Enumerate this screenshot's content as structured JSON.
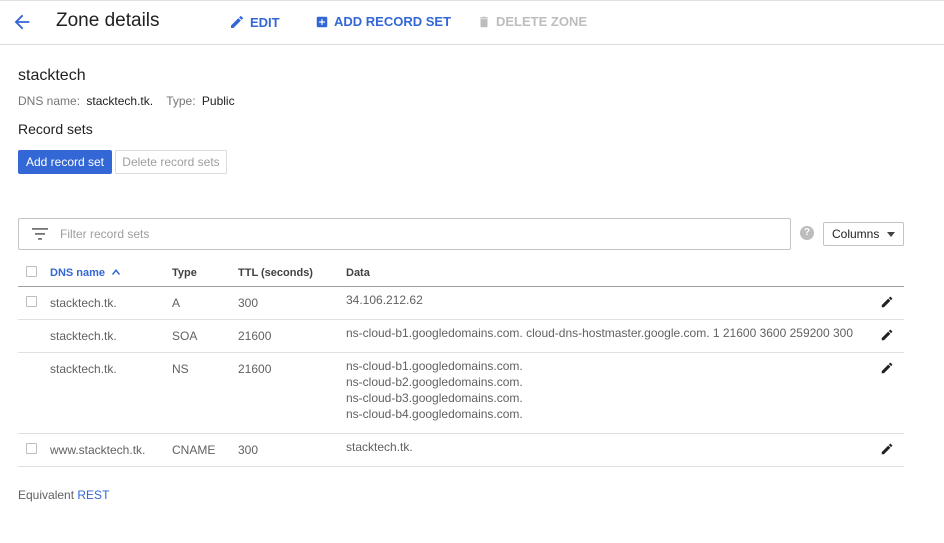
{
  "header": {
    "title": "Zone details",
    "edit_label": "EDIT",
    "add_record_set_label": "ADD RECORD SET",
    "delete_zone_label": "DELETE ZONE"
  },
  "zone": {
    "name": "stacktech",
    "dns_name_label": "DNS name:",
    "dns_name": "stacktech.tk.",
    "type_label": "Type:",
    "type": "Public"
  },
  "record_sets": {
    "title": "Record sets",
    "add_label": "Add record set",
    "delete_label": "Delete record sets",
    "filter_placeholder": "Filter record sets",
    "columns_label": "Columns",
    "headers": {
      "dns_name": "DNS name",
      "type": "Type",
      "ttl": "TTL (seconds)",
      "data": "Data"
    },
    "rows": [
      {
        "name": "stacktech.tk.",
        "type": "A",
        "ttl": "300",
        "data": [
          "34.106.212.62"
        ],
        "checkbox": true
      },
      {
        "name": "stacktech.tk.",
        "type": "SOA",
        "ttl": "21600",
        "data": [
          "ns-cloud-b1.googledomains.com. cloud-dns-hostmaster.google.com. 1 21600 3600 259200 300"
        ],
        "checkbox": false
      },
      {
        "name": "stacktech.tk.",
        "type": "NS",
        "ttl": "21600",
        "data": [
          "ns-cloud-b1.googledomains.com.",
          "ns-cloud-b2.googledomains.com.",
          "ns-cloud-b3.googledomains.com.",
          "ns-cloud-b4.googledomains.com."
        ],
        "checkbox": false
      },
      {
        "name": "www.stacktech.tk.",
        "type": "CNAME",
        "ttl": "300",
        "data": [
          "stacktech.tk."
        ],
        "checkbox": true
      }
    ]
  },
  "footer": {
    "prefix": "Equivalent",
    "link": "REST"
  },
  "colors": {
    "accent": "#3367d6",
    "disabled": "#bdbdbd"
  }
}
